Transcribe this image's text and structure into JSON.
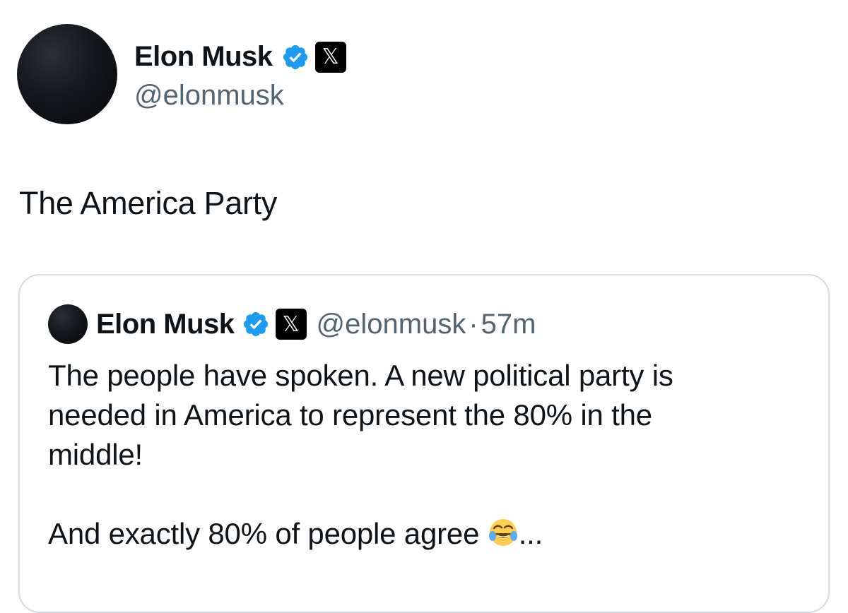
{
  "author": {
    "display_name": "Elon Musk",
    "handle": "@elonmusk",
    "verified_icon": "verified-badge-icon",
    "affiliation_icon": "x-logo-icon"
  },
  "tweet": {
    "text": "The America Party"
  },
  "quoted_tweet": {
    "display_name": "Elon Musk",
    "handle": "@elonmusk",
    "separator": "·",
    "time": "57m",
    "line1": "The people have spoken. A new political party is",
    "line2": "needed in America to represent the 80% in the",
    "line3": "middle!",
    "line4": "And exactly 80% of people agree ",
    "ellipsis": "...",
    "emoji_icon": "tears-of-joy-emoji-icon"
  },
  "colors": {
    "verified_blue": "#1d9bf0",
    "text_primary": "#0f1419",
    "text_secondary": "#536471",
    "border": "#d6dce1"
  },
  "x_glyph": "𝕏"
}
